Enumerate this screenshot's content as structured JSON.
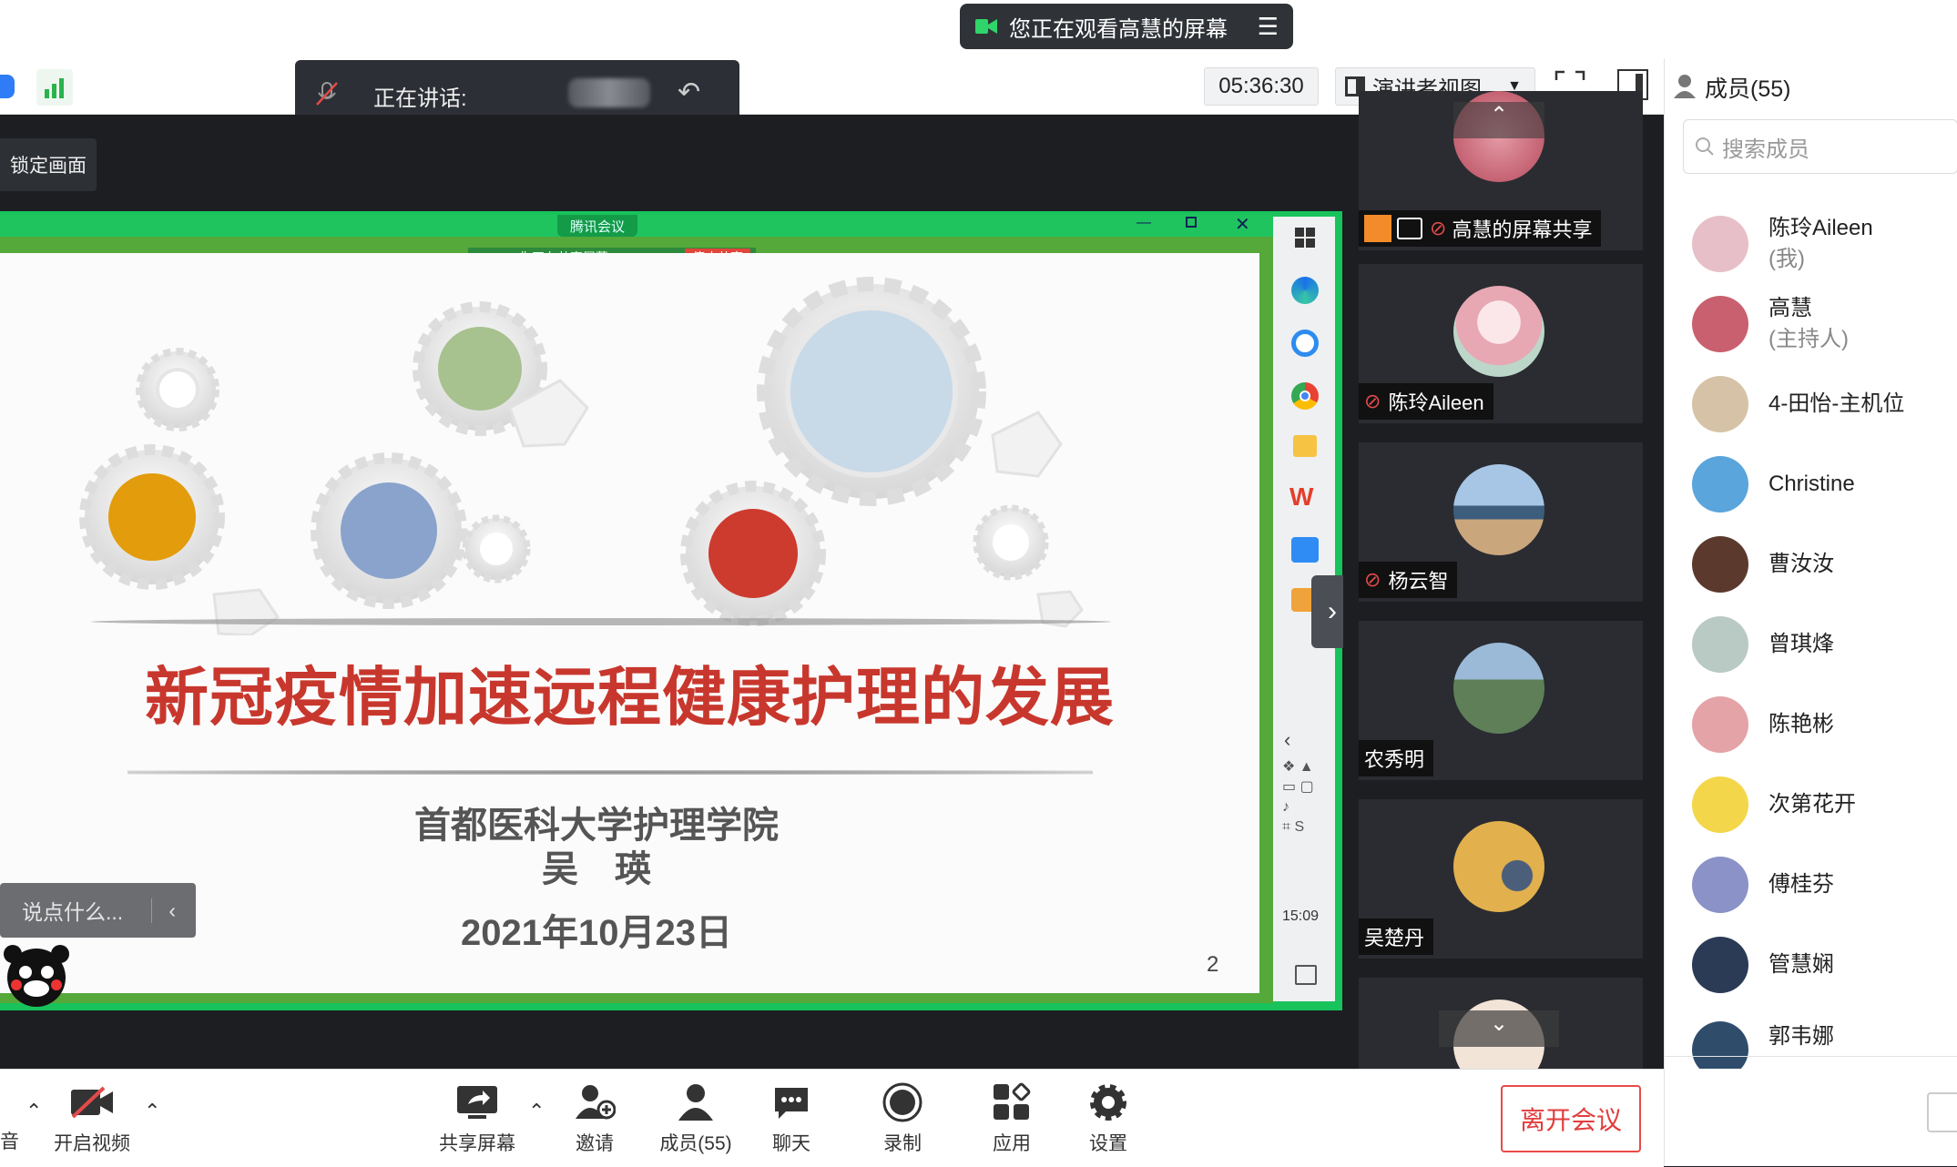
{
  "banner": {
    "text": "您正在观看高慧的屏幕"
  },
  "speaking": {
    "label": "正在讲话:"
  },
  "toolbar": {
    "time": "05:36:30",
    "view_mode": "演讲者视图",
    "members_label": "成员(55)"
  },
  "stage": {
    "lock_label": "锁定画面",
    "chat_placeholder": "说点什么..."
  },
  "shared_window": {
    "app_title": "腾讯会议",
    "sharing_label": "你正在共享屏幕",
    "stop_label": "停止共享"
  },
  "slide": {
    "title": "新冠疫情加速远程健康护理的发展",
    "institution": "首都医科大学护理学院",
    "author": "吴　瑛",
    "date": "2021年10月23日",
    "page_number": "2"
  },
  "taskbar": {
    "clock": "15:09"
  },
  "video_tiles": [
    {
      "name": "高慧的屏幕共享",
      "avatar_color": "#c75a6c"
    },
    {
      "name": "陈玲Aileen",
      "avatar_color": "#e8b9c2"
    },
    {
      "name": "杨云智",
      "avatar_color": "#6e8fb0"
    },
    {
      "name": "农秀明",
      "avatar_color": "#5b7a5a"
    },
    {
      "name": "吴楚丹",
      "avatar_color": "#d9a741"
    }
  ],
  "members_panel": {
    "search_placeholder": "搜索成员",
    "members": [
      {
        "name": "陈玲Aileen",
        "role": "(我)",
        "avatar_color": "#e7bfc8"
      },
      {
        "name": "高慧",
        "role": "(主持人)",
        "avatar_color": "#c9606f"
      },
      {
        "name": "4-田怡-主机位",
        "role": "",
        "avatar_color": "#d6c3a7"
      },
      {
        "name": "Christine",
        "role": "",
        "avatar_color": "#5aa5db"
      },
      {
        "name": "曹汝汝",
        "role": "",
        "avatar_color": "#5b3a2d"
      },
      {
        "name": "曾琪烽",
        "role": "",
        "avatar_color": "#b9c9c4"
      },
      {
        "name": "陈艳彬",
        "role": "",
        "avatar_color": "#e4a3a7"
      },
      {
        "name": "次第花开",
        "role": "",
        "avatar_color": "#f3d64a"
      },
      {
        "name": "傅桂芬",
        "role": "",
        "avatar_color": "#8a92c7"
      },
      {
        "name": "管慧娴",
        "role": "",
        "avatar_color": "#2b3a55"
      },
      {
        "name": "郭韦娜",
        "role": "",
        "avatar_color": "#2f4d6b"
      }
    ]
  },
  "bottom_bar": {
    "audio_label": "音",
    "video_label": "开启视频",
    "share_label": "共享屏幕",
    "invite_label": "邀请",
    "members_label": "成员(55)",
    "chat_label": "聊天",
    "record_label": "录制",
    "apps_label": "应用",
    "settings_label": "设置",
    "leave_label": "离开会议"
  },
  "colors": {
    "accent_green": "#19c35c",
    "leave_red": "#e23c3c",
    "slide_title_red": "#c8372d"
  }
}
